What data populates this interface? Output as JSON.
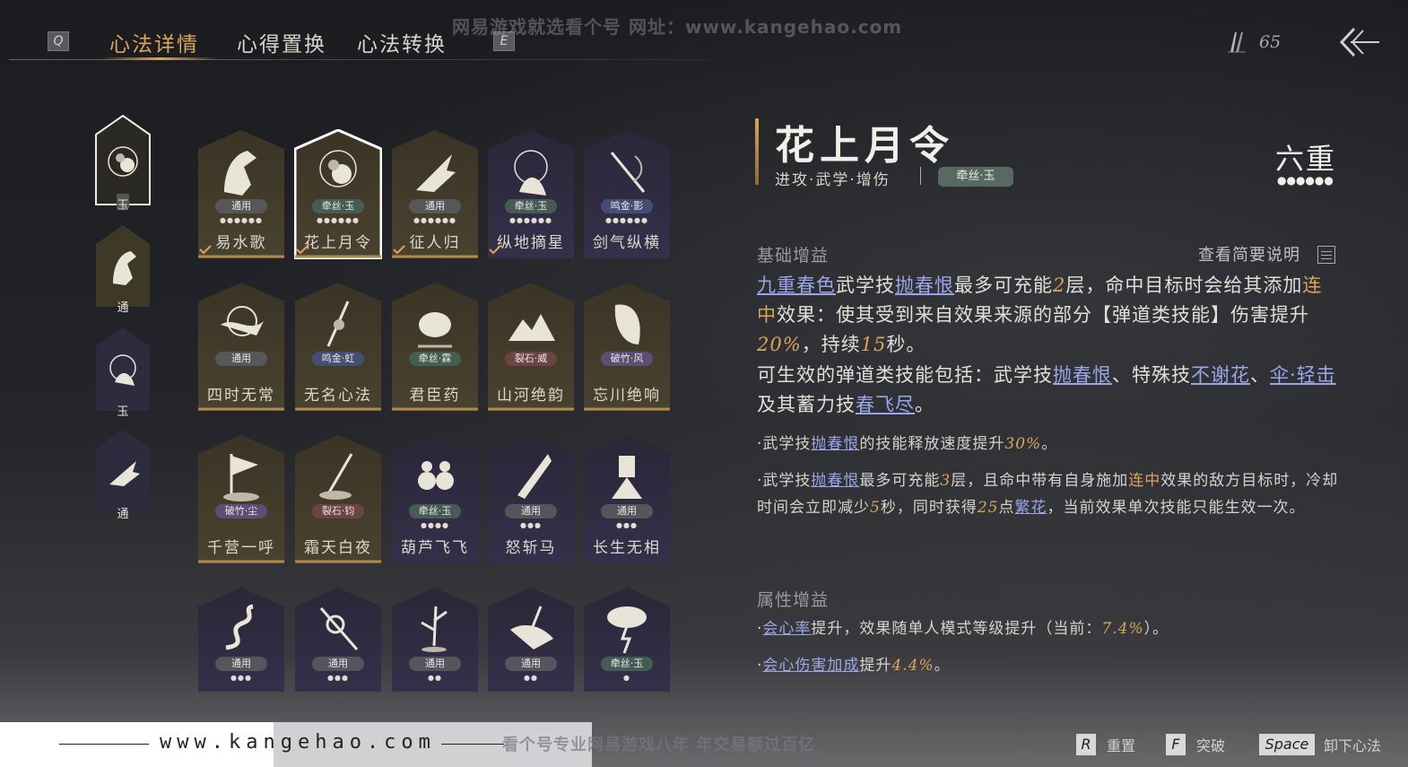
{
  "topbar": {
    "key_left": "Q",
    "key_right": "E",
    "tabs": [
      {
        "label": "心法详情",
        "active": true
      },
      {
        "label": "心得置换",
        "active": false
      },
      {
        "label": "心法转换",
        "active": false
      }
    ],
    "watermark_top": "网易游戏就选看个号   网址：www.kangehao.com",
    "currency_value": "65",
    "currency_icon": "feather-icon",
    "back_icon": "back-arrow-icon"
  },
  "sidebar": [
    {
      "label": "玉",
      "icon": "peony-icon",
      "selected": true
    },
    {
      "label": "通",
      "icon": "horse-icon",
      "selected": false
    },
    {
      "label": "玉",
      "icon": "spirit-icon",
      "selected": false
    },
    {
      "label": "通",
      "icon": "bird-hand-icon",
      "selected": false
    }
  ],
  "cards": [
    {
      "name": "易水歌",
      "badge": "通用",
      "badge_type": "gen",
      "dots": "●●●●●●",
      "checked": true,
      "icon": "horse-icon",
      "tone": "gold"
    },
    {
      "name": "花上月令",
      "badge": "牵丝·玉",
      "badge_type": "qs",
      "dots": "●●●●●●",
      "checked": true,
      "icon": "peony-icon",
      "tone": "gold",
      "selected": true
    },
    {
      "name": "征人归",
      "badge": "通用",
      "badge_type": "gen",
      "dots": "●●●●●●",
      "checked": true,
      "icon": "bird-hand-icon",
      "tone": "gold"
    },
    {
      "name": "纵地摘星",
      "badge": "牵丝·玉",
      "badge_type": "qs",
      "dots": "●●●●●●",
      "checked": true,
      "icon": "spirit-icon",
      "tone": "purple"
    },
    {
      "name": "剑气纵横",
      "badge": "鸣金·影",
      "badge_type": "mj",
      "dots": "●●●●●●",
      "checked": false,
      "icon": "sword-icon",
      "tone": "purple"
    },
    {
      "name": "四时无常",
      "badge": "通用",
      "badge_type": "gen",
      "dots": "",
      "checked": false,
      "icon": "fish-moon-icon",
      "tone": "gold"
    },
    {
      "name": "无名心法",
      "badge": "鸣金·虹",
      "badge_type": "mj",
      "dots": "",
      "checked": false,
      "icon": "spear-icon",
      "tone": "gold"
    },
    {
      "name": "君臣药",
      "badge": "牵丝·霖",
      "badge_type": "qs",
      "dots": "",
      "checked": false,
      "icon": "herb-pot-icon",
      "tone": "gold"
    },
    {
      "name": "山河绝韵",
      "badge": "裂石·威",
      "badge_type": "ls",
      "dots": "",
      "checked": false,
      "icon": "mountain-icon",
      "tone": "gold"
    },
    {
      "name": "忘川绝响",
      "badge": "破竹·风",
      "badge_type": "cz",
      "dots": "",
      "checked": false,
      "icon": "mask-icon",
      "tone": "gold"
    },
    {
      "name": "千营一呼",
      "badge": "破竹·尘",
      "badge_type": "cz",
      "dots": "",
      "checked": false,
      "icon": "flag-icon",
      "tone": "gold"
    },
    {
      "name": "霜天白夜",
      "badge": "裂石·钧",
      "badge_type": "ls",
      "dots": "",
      "checked": false,
      "icon": "blade-icon",
      "tone": "gold"
    },
    {
      "name": "葫芦飞飞",
      "badge": "牵丝·玉",
      "badge_type": "qs",
      "dots": "●●●●",
      "checked": false,
      "icon": "gourd-icon",
      "tone": "purple"
    },
    {
      "name": "怒斩马",
      "badge": "通用",
      "badge_type": "gen",
      "dots": "●●●",
      "checked": false,
      "icon": "broadsword-icon",
      "tone": "purple"
    },
    {
      "name": "长生无相",
      "badge": "通用",
      "badge_type": "gen",
      "dots": "●●●",
      "checked": false,
      "icon": "statue-icon",
      "tone": "purple"
    },
    {
      "name": "",
      "badge": "通用",
      "badge_type": "gen",
      "dots": "●●●",
      "checked": false,
      "icon": "dragon-icon",
      "tone": "purple"
    },
    {
      "name": "",
      "badge": "通用",
      "badge_type": "gen",
      "dots": "●●●",
      "checked": false,
      "icon": "snake-sword-icon",
      "tone": "purple"
    },
    {
      "name": "",
      "badge": "通用",
      "badge_type": "gen",
      "dots": "●●",
      "checked": false,
      "icon": "bamboo-icon",
      "tone": "purple"
    },
    {
      "name": "",
      "badge": "通用",
      "badge_type": "gen",
      "dots": "●●",
      "checked": false,
      "icon": "cliff-sword-icon",
      "tone": "purple"
    },
    {
      "name": "",
      "badge": "牵丝·玉",
      "badge_type": "qs",
      "dots": "●",
      "checked": false,
      "icon": "tree-lightning-icon",
      "tone": "purple"
    }
  ],
  "detail": {
    "title": "花上月令",
    "tags": "进攻·武学·增伤",
    "badge": "牵丝·玉",
    "rank": "六重",
    "rank_dots": "●●●●●●",
    "section_base": "基础增益",
    "more_label": "查看简要说明",
    "base_p1": {
      "a": "九重春色",
      "b": "武学技",
      "c": "抛春恨",
      "d": "最多可充能",
      "e": "2",
      "f": "层，命中目标时会给其添加",
      "g": "连中",
      "h": "效果：使其受到来自效果来源的部分【弹道类技能】伤害提升",
      "i": "20%",
      "j": "，持续",
      "k": "15",
      "l": "秒。"
    },
    "base_p2": {
      "a": "可生效的弹道类技能包括：武学技",
      "b": "抛春恨",
      "c": "、特殊技",
      "d": "不谢花",
      "e": "、",
      "f": "伞·轻击",
      "g": "及其蓄力技",
      "h": "春飞尽",
      "i": "。"
    },
    "bullet1": {
      "a": "·武学技",
      "b": "抛春恨",
      "c": "的技能释放速度提升",
      "d": "30%",
      "e": "。"
    },
    "bullet2": {
      "a": "·武学技",
      "b": "抛春恨",
      "c": "最多可充能",
      "d": "3",
      "e": "层，且命中带有自身施加",
      "f": "连中",
      "g": "效果的敌方目标时，冷却时间会立即减少",
      "h": "5",
      "i": "秒，同时获得",
      "j": "25",
      "k": "点",
      "l": "繁花",
      "m": "，当前效果单次技能只能生效一次。"
    },
    "section_attr": "属性增益",
    "attr1": {
      "a": "·",
      "b": "会心率",
      "c": "提升，效果随单人模式等级提升（当前：",
      "d": "7.4%",
      "e": "）。"
    },
    "attr2": {
      "a": "·",
      "b": "会心伤害加成",
      "c": "提升",
      "d": "4.4%",
      "e": "。"
    }
  },
  "bottom": {
    "site": "www.kangehao.com",
    "watermark": "看个号专业网易游戏八年   年交易额过百亿",
    "hints": [
      {
        "key": "R",
        "label": "重置"
      },
      {
        "key": "F",
        "label": "突破"
      },
      {
        "key": "Space",
        "label": "卸下心法"
      }
    ]
  },
  "colors": {
    "accent_gold": "#d9a55a",
    "link_blue": "#9aa6e8",
    "card_gold": "#4a4230",
    "card_purple": "#34304a"
  }
}
